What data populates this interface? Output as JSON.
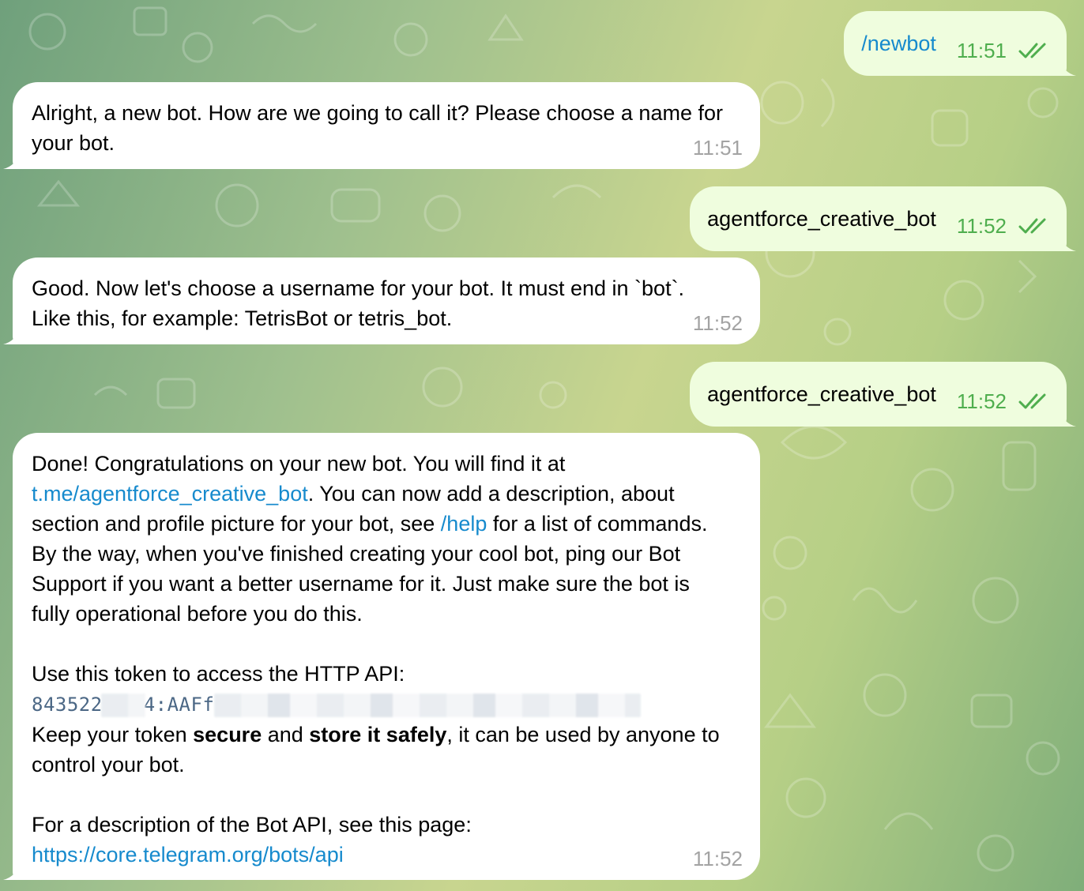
{
  "messages": [
    {
      "id": "m1",
      "direction": "outgoing",
      "text": "/newbot",
      "time": "11:51",
      "status": "read"
    },
    {
      "id": "m2",
      "direction": "incoming",
      "text": "Alright, a new bot. How are we going to call it? Please choose a name for your bot.",
      "time": "11:51"
    },
    {
      "id": "m3",
      "direction": "outgoing",
      "text": "agentforce_creative_bot",
      "time": "11:52",
      "status": "read"
    },
    {
      "id": "m4",
      "direction": "incoming",
      "text": "Good. Now let's choose a username for your bot. It must end in `bot`. Like this, for example: TetrisBot or tetris_bot.",
      "time": "11:52"
    },
    {
      "id": "m5",
      "direction": "outgoing",
      "text": "agentforce_creative_bot",
      "time": "11:52",
      "status": "read"
    },
    {
      "id": "m6",
      "direction": "incoming",
      "time": "11:52",
      "p1_start": "Done! Congratulations on your new bot. You will find it at ",
      "p1_link": "t.me/agentforce_creative_bot",
      "p1_mid": ". You can now add a description, about section and profile picture for your bot, see ",
      "p1_cmd": "/help",
      "p1_end": " for a list of commands. By the way, when you've finished creating your cool bot, ping our Bot Support if you want a better username for it. Just make sure the bot is fully operational before you do this.",
      "p2_intro": "Use this token to access the HTTP API:",
      "token_part1": "843522",
      "token_part2": "4:AAFf",
      "p3_a": "Keep your token ",
      "p3_bold1": "secure",
      "p3_b": " and ",
      "p3_bold2": "store it safely",
      "p3_c": ", it can be used by anyone to control your bot.",
      "p4_intro": "For a description of the Bot API, see this page:",
      "p4_link": "https://core.telegram.org/bots/api"
    }
  ],
  "colors": {
    "incoming_bubble": "#ffffff",
    "outgoing_bubble": "#effdde",
    "outgoing_time": "#4fae4e",
    "incoming_time": "#a3a3a3",
    "link": "#168acd",
    "token_text": "#4b6785"
  }
}
